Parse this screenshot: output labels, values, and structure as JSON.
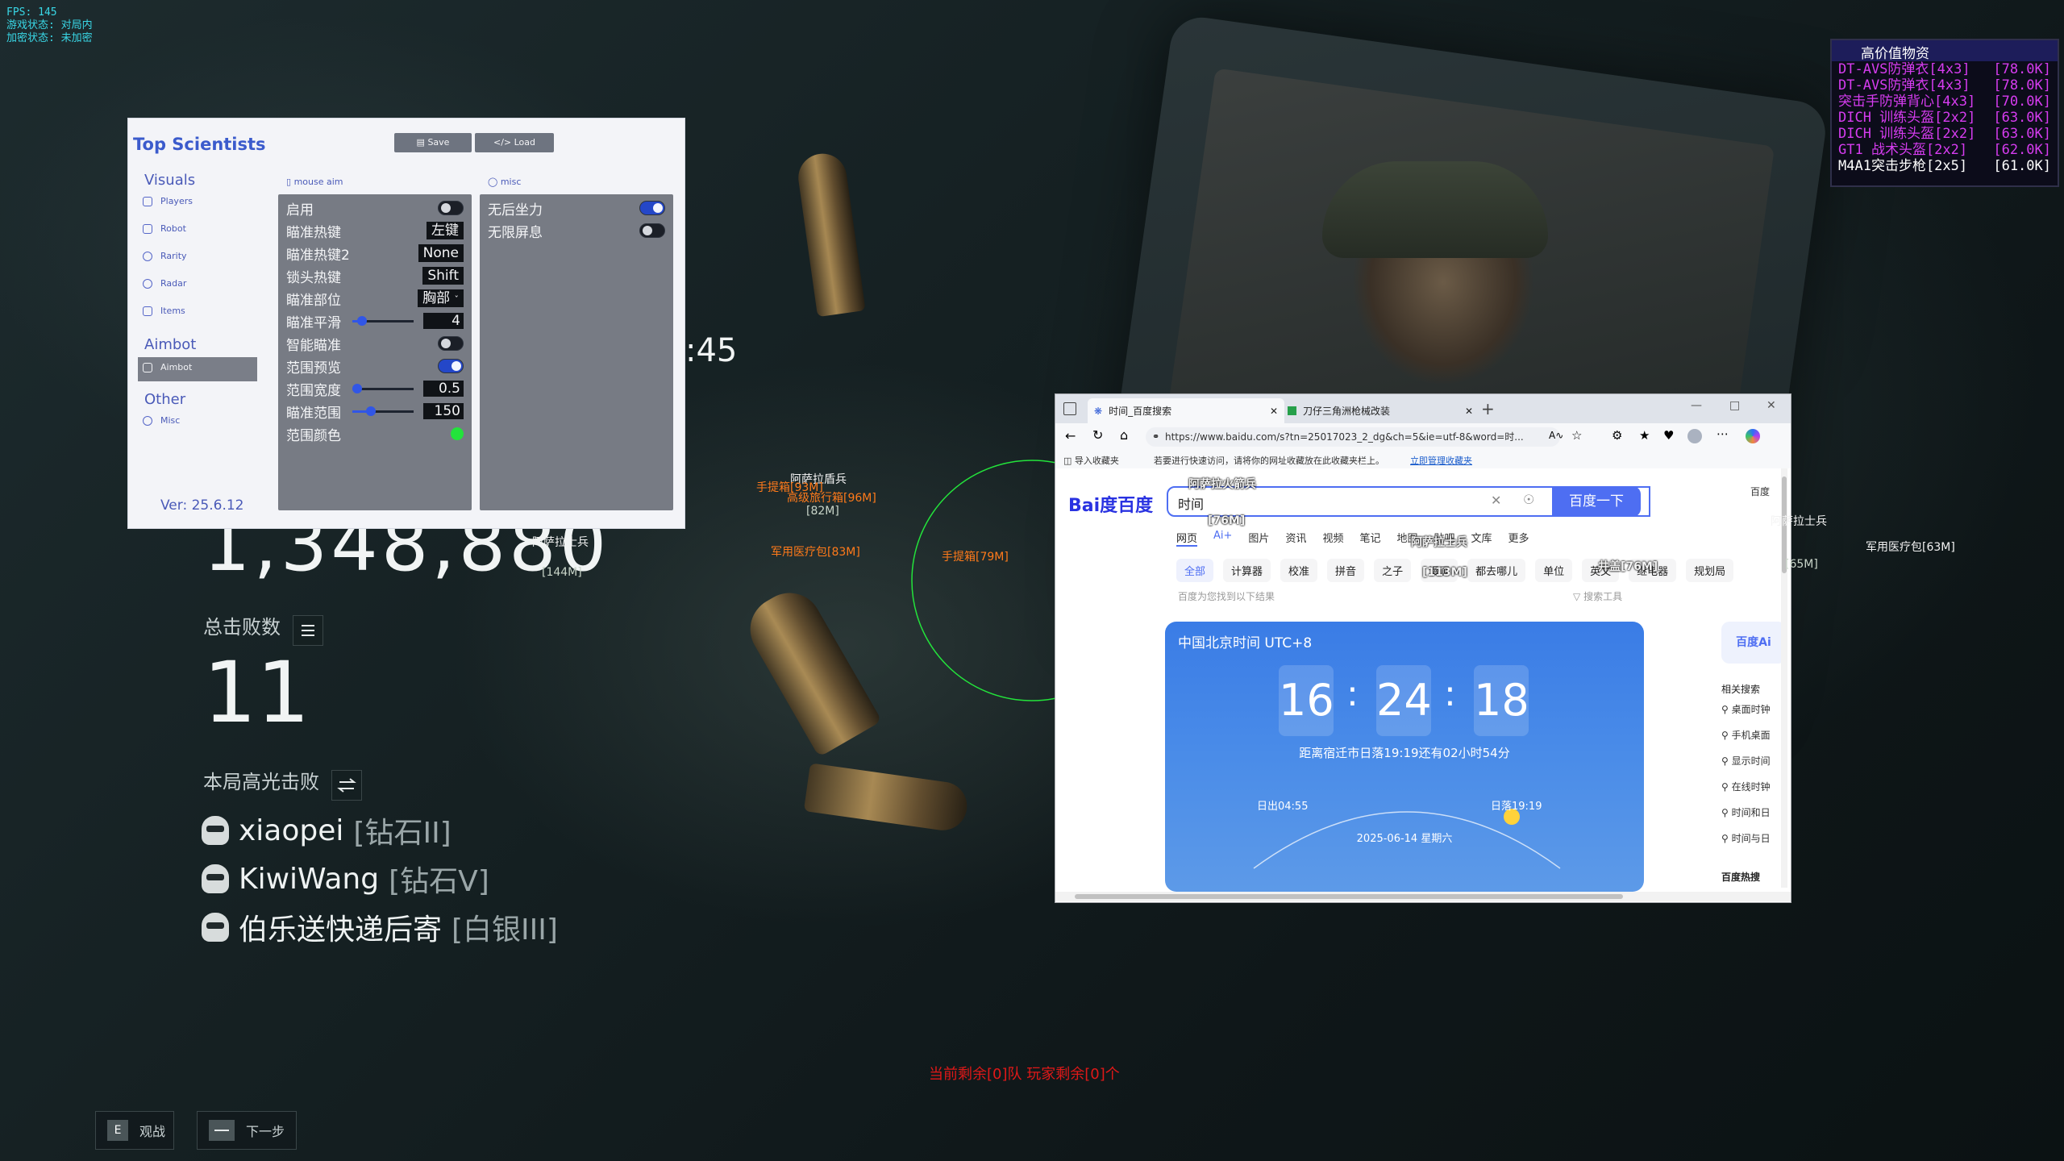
{
  "hud": {
    "fps": "FPS: 145",
    "game_state": "游戏状态: 对局内",
    "encryption": "加密状态: 未加密"
  },
  "loot_panel": {
    "title": "高价值物资",
    "items": [
      {
        "name": "DT-AVS防弹衣[4x3]",
        "value": "[78.0K]",
        "color": "#d63cf0"
      },
      {
        "name": "DT-AVS防弹衣[4x3]",
        "value": "[78.0K]",
        "color": "#d63cf0"
      },
      {
        "name": "突击手防弹背心[4x3]",
        "value": "[70.0K]",
        "color": "#d63cf0"
      },
      {
        "name": "DICH 训练头盔[2x2]",
        "value": "[63.0K]",
        "color": "#d63cf0"
      },
      {
        "name": "DICH 训练头盔[2x2]",
        "value": "[63.0K]",
        "color": "#d63cf0"
      },
      {
        "name": "GT1 战术头盔[2x2]",
        "value": "[62.0K]",
        "color": "#d63cf0"
      },
      {
        "name": "M4A1突击步枪[2x5]",
        "value": "[61.0K]",
        "color": "#ffffff"
      }
    ]
  },
  "summary": {
    "partial_time": ":45",
    "big_number": "1,348,880",
    "total_kills_label": "总击败数",
    "total_kills": "11",
    "highlight_label": "本局高光击败",
    "players": [
      {
        "name": "xiaopei",
        "rank": "[钻石II]"
      },
      {
        "name": "KiwiWang",
        "rank": "[钻石V]"
      },
      {
        "name": "伯乐送快递后寄",
        "rank": "[白银III]"
      }
    ]
  },
  "bottom_buttons": {
    "spectate_key": "E",
    "spectate_label": "观战",
    "next_label": "下一步"
  },
  "remaining_text": "当前剩余[0]队  玩家剩余[0]个",
  "esp_labels": [
    {
      "text": "阿萨拉士兵",
      "color": "white"
    },
    {
      "text": "[144M]",
      "color": "grey"
    },
    {
      "text": "阿萨拉盾兵",
      "color": "white"
    },
    {
      "text": "手提箱[93M]",
      "color": "orange"
    },
    {
      "text": "高级旅行箱[96M]",
      "color": "orange"
    },
    {
      "text": "[82M]",
      "color": "grey"
    },
    {
      "text": "军用医疗包[83M]",
      "color": "orange"
    },
    {
      "text": "手提箱[79M]",
      "color": "orange"
    },
    {
      "text": "阿萨拉火箭兵",
      "color": "white"
    },
    {
      "text": "[76M]",
      "color": "white"
    },
    {
      "text": "阿萨拉士兵",
      "color": "white"
    },
    {
      "text": "[113M]",
      "color": "white"
    },
    {
      "text": "井盖[76M]",
      "color": "white"
    },
    {
      "text": "阿萨拉士兵",
      "color": "white"
    },
    {
      "text": "[65M]",
      "color": "grey"
    },
    {
      "text": "军用医疗包[63M]",
      "color": "orange"
    }
  ],
  "panel": {
    "title": "Top Scientists",
    "save_label": "Save",
    "load_label": "Load",
    "nav": {
      "visuals": "Visuals",
      "players": "Players",
      "robot": "Robot",
      "rarity": "Rarity",
      "radar": "Radar",
      "items": "Items",
      "aimbot": "Aimbot",
      "aimbot_item": "Aimbot",
      "other": "Other",
      "misc": "Misc"
    },
    "version": "Ver: 25.6.12",
    "mouse_aim_header": "mouse aim",
    "misc_header": "misc",
    "mouse_aim": {
      "enable": "启用",
      "aim_key": "瞄准热键",
      "aim_key_val": "左键",
      "aim_key2": "瞄准热键2",
      "aim_key2_val": "None",
      "lock_key": "锁头热键",
      "lock_key_val": "Shift",
      "aim_part": "瞄准部位",
      "aim_part_val": "胸部",
      "smooth": "瞄准平滑",
      "smooth_val": "4",
      "smart_aim": "智能瞄准",
      "fov_preview": "范围预览",
      "fov_width": "范围宽度",
      "fov_width_val": "0.5",
      "fov_range": "瞄准范围",
      "fov_range_val": "150",
      "fov_color": "范围颜色"
    },
    "misc": {
      "no_recoil": "无后坐力",
      "no_flash": "无限屏息"
    },
    "toggles": {
      "enable": false,
      "smart_aim": false,
      "fov_preview": true,
      "no_recoil": true,
      "no_flash": false
    },
    "slider_fill": {
      "smooth": 0.1,
      "fov_width": 0.02,
      "fov_range": 0.25
    },
    "fov_color_value": "#23e33b"
  },
  "browser": {
    "tabs": [
      {
        "title": "时间_百度搜索"
      },
      {
        "title": "刀仔三角洲枪械改装"
      }
    ],
    "url": "https://www.baidu.com/s?tn=25017023_2_dg&ch=5&ie=utf-8&word=时...",
    "import_fav": "导入收藏夹",
    "fav_notice": "若要进行快速访问，请将你的网址收藏放在此收藏夹栏上。",
    "fav_link": "立即管理收藏夹",
    "logo": "Bai度百度",
    "query": "时间",
    "search_button": "百度一下",
    "content_tabs": [
      "网页",
      "Ai+",
      "图片",
      "资讯",
      "视频",
      "笔记",
      "地图",
      "贴吧",
      "文库",
      "更多"
    ],
    "chips": [
      "全部",
      "计算器",
      "校准",
      "拼音",
      "之子",
      "漫画",
      "都去哪儿",
      "单位",
      "英文",
      "继电器",
      "规划局"
    ],
    "result_hint": "百度为您找到以下结果",
    "search_tools": "搜索工具",
    "card_title": "中国北京时间 UTC+8",
    "hour": "16",
    "minute": "24",
    "second": "18",
    "sunset_note": "距离宿迁市日落19:19还有02小时54分",
    "sunrise": "日出04:55",
    "sunset": "日落19:19",
    "date": "2025-06-14  星期六",
    "right_top": "百度",
    "ai_btn": "百度Ai",
    "related_title": "相关搜索",
    "related": [
      "桌面时钟",
      "手机桌面",
      "显示时间",
      "在线时钟",
      "时间和日",
      "时间与日"
    ],
    "hot": "百度热搜"
  }
}
